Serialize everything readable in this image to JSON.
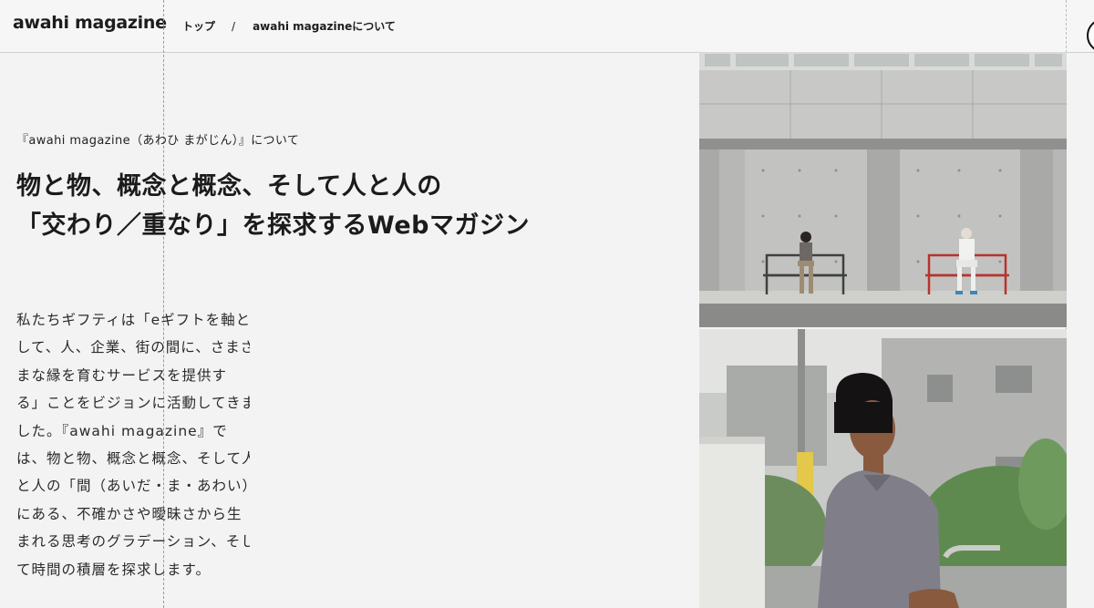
{
  "header": {
    "logo": "awahi magazine",
    "breadcrumb": [
      {
        "label": "トップ"
      },
      {
        "label": "awahi magazineについて"
      }
    ],
    "separator": "/"
  },
  "main": {
    "eyebrow": "『awahi magazine（あわひ まがじん）』について",
    "headline_lines": [
      "物と物、概念と概念、そして人と人の",
      "「交わり／重なり」を探求するWebマガジン"
    ],
    "body_lines": [
      "私たちギフティは「eギフトを軸と",
      "して、人、企業、街の間に、さまざ",
      "まな縁を育むサービスを提供す",
      "る」ことをビジョンに活動してきま",
      "した。『awahi magazine』で",
      "は、物と物、概念と概念、そして人",
      "と人の「間（あいだ・ま・あわい）」",
      "にある、不確かさや曖昧さから生",
      "まれる思考のグラデーション、そし",
      "て時間の積層を探求します。"
    ]
  },
  "photos": [
    {
      "name": "two people on benches"
    },
    {
      "name": "woman on street"
    }
  ],
  "colors": {
    "background": "#f3f3f3",
    "text": "#222222",
    "bench_red": "#b8332e"
  }
}
